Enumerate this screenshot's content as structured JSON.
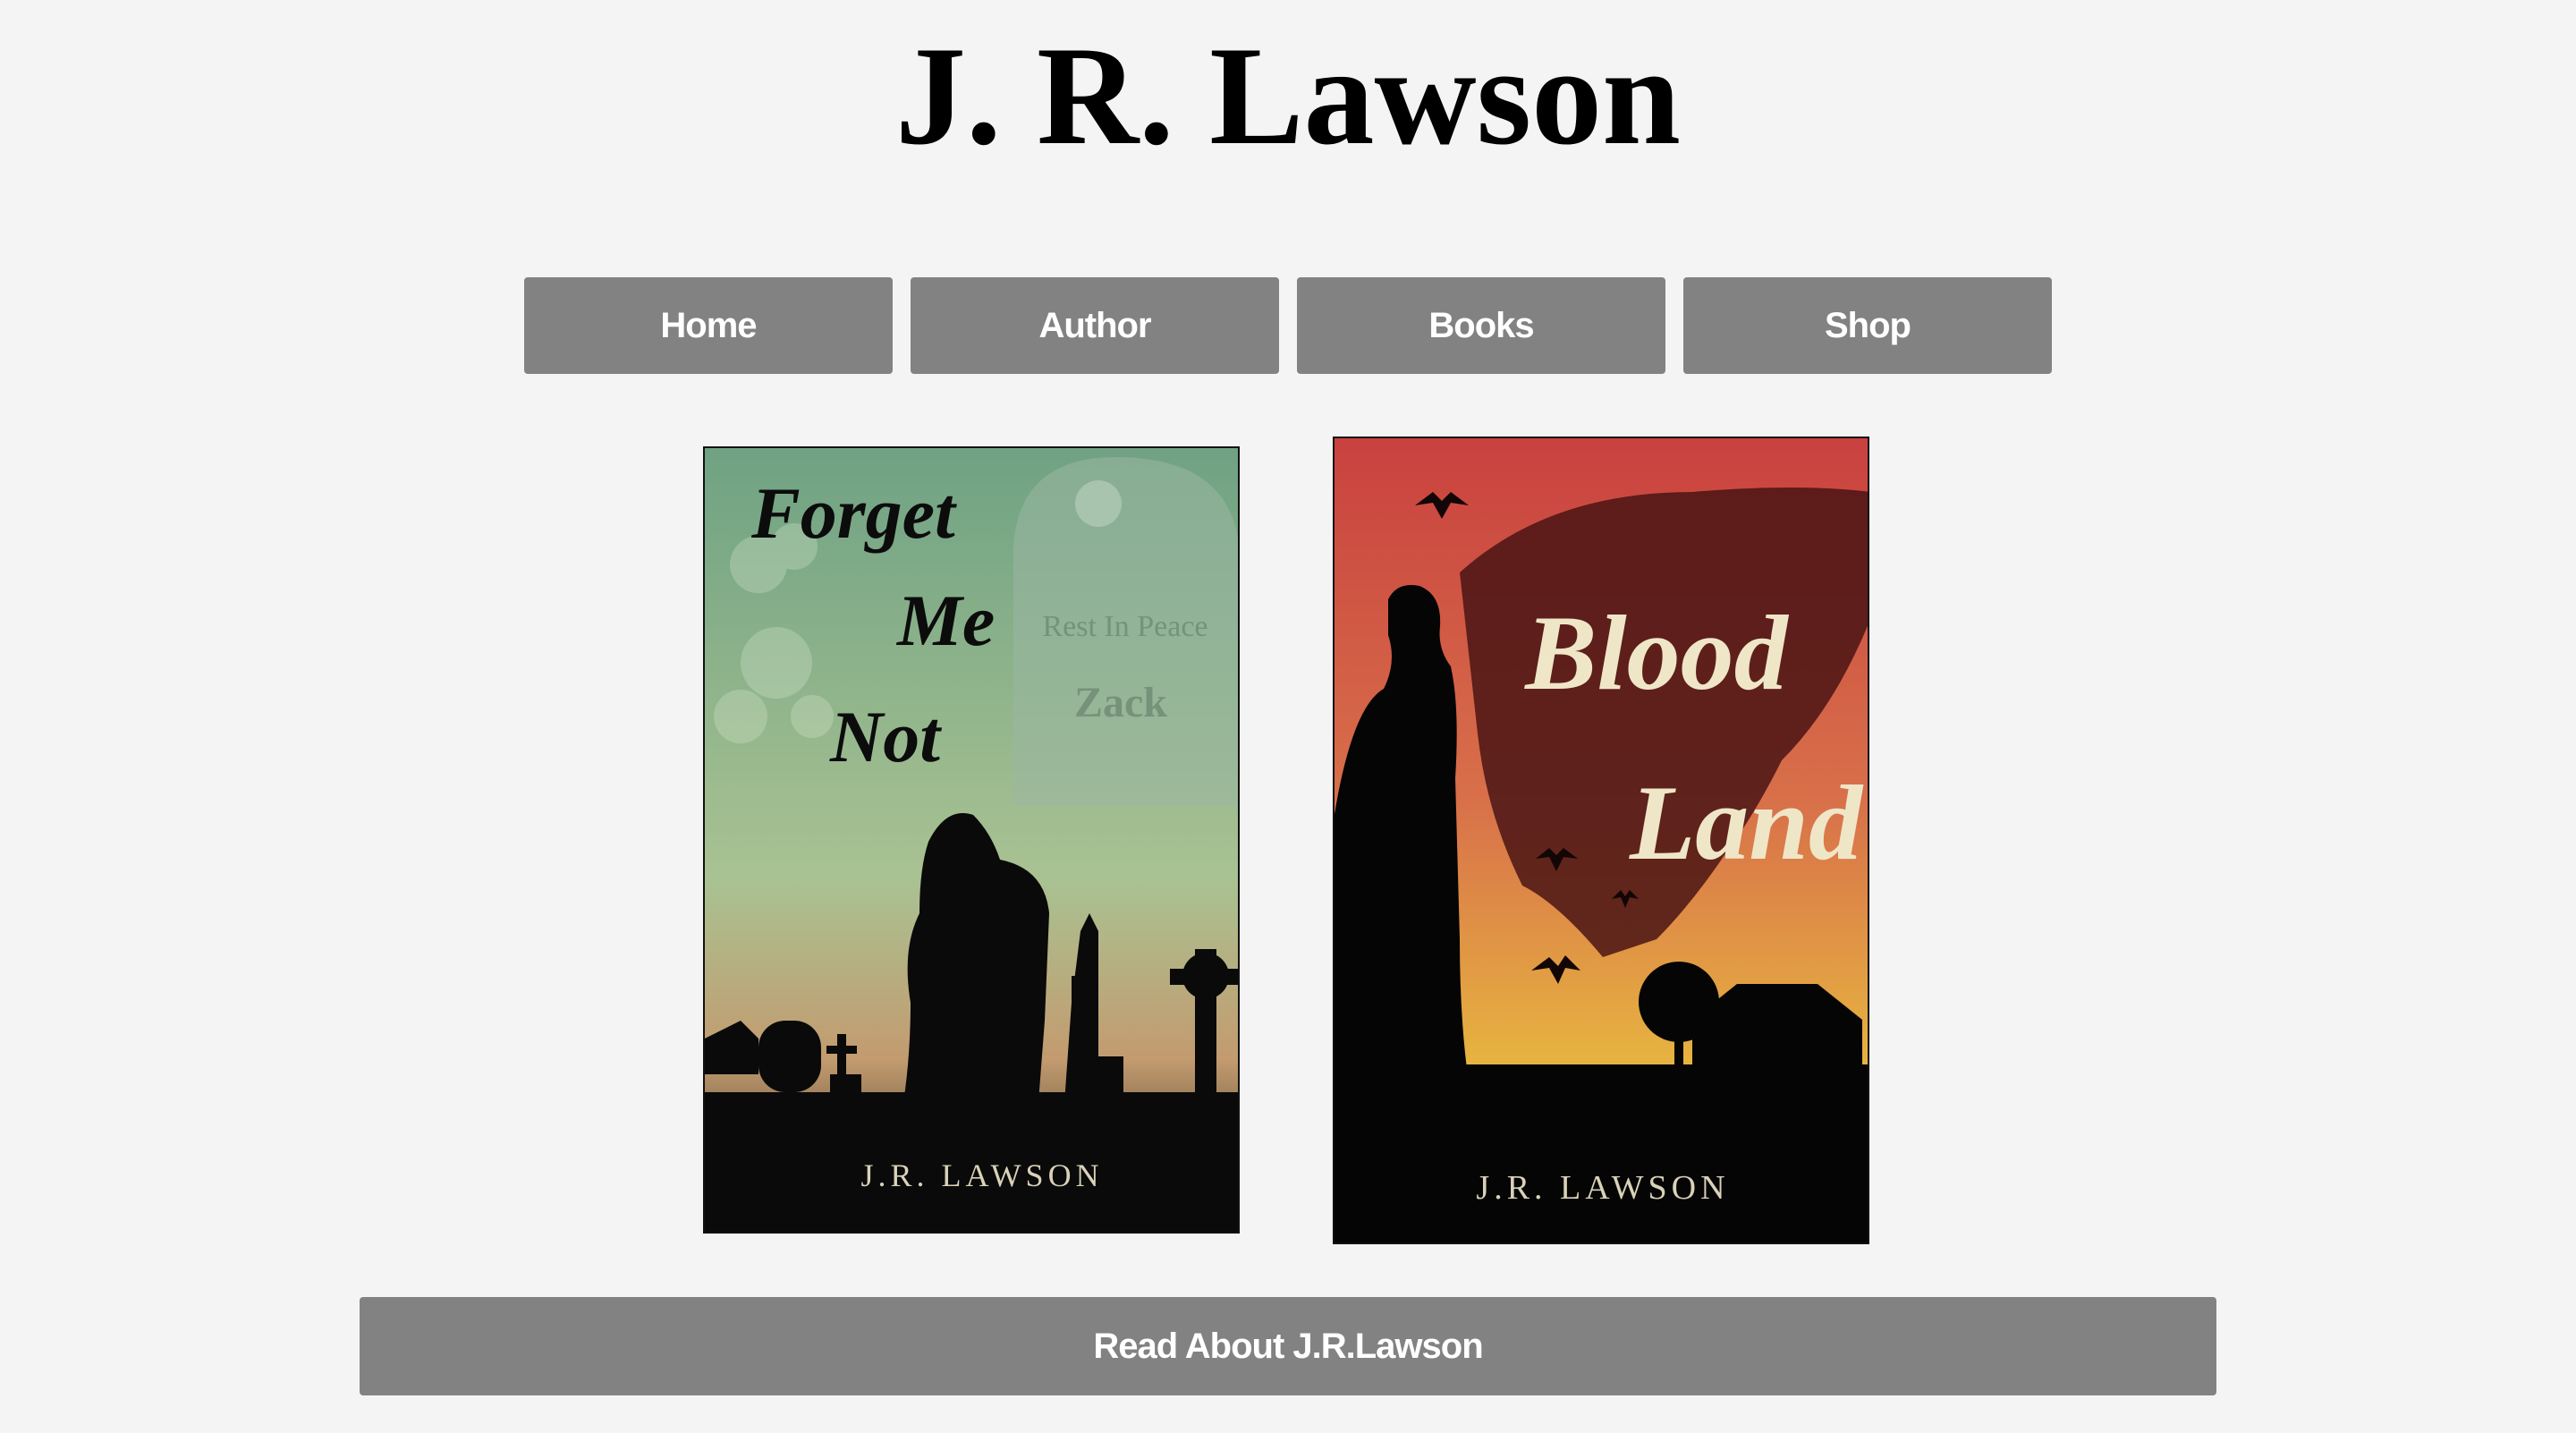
{
  "site": {
    "title": "J. R. Lawson"
  },
  "nav": {
    "items": [
      {
        "label": "Home"
      },
      {
        "label": "Author"
      },
      {
        "label": "Books"
      },
      {
        "label": "Shop"
      }
    ]
  },
  "books": [
    {
      "title_lines": [
        "Forget",
        "Me",
        "Not"
      ],
      "tombstone_text": [
        "Rest In Peace",
        "Zack"
      ],
      "author": "J.R. LAWSON",
      "colors": {
        "top": "#6fa283",
        "mid": "#a9c292",
        "bottom": "#c39b6f"
      }
    },
    {
      "title_lines": [
        "Blood",
        "Land"
      ],
      "author": "J.R. LAWSON",
      "colors": {
        "top": "#c9413f",
        "mid": "#d8704a",
        "bottom": "#e7b440"
      }
    }
  ],
  "cta": {
    "label": "Read About J.R.Lawson"
  },
  "colors": {
    "background": "#f4f4f4",
    "button": "#828282",
    "button_text": "#ffffff"
  }
}
